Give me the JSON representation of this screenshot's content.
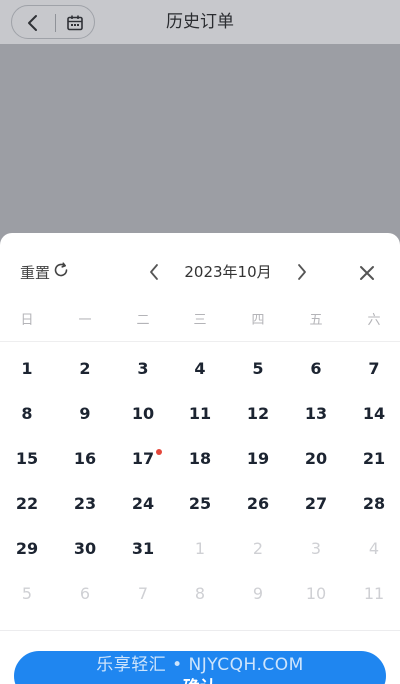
{
  "header": {
    "title": "历史订单",
    "back_icon": "chevron-left-icon",
    "calendar_icon": "calendar-icon"
  },
  "calendar": {
    "reset_label": "重置",
    "month_label": "2023年10月",
    "weekdays": [
      "日",
      "一",
      "二",
      "三",
      "四",
      "五",
      "六"
    ],
    "weeks": [
      [
        {
          "d": "1",
          "m": false
        },
        {
          "d": "2",
          "m": false
        },
        {
          "d": "3",
          "m": false
        },
        {
          "d": "4",
          "m": false
        },
        {
          "d": "5",
          "m": false
        },
        {
          "d": "6",
          "m": false
        },
        {
          "d": "7",
          "m": false
        }
      ],
      [
        {
          "d": "8",
          "m": false
        },
        {
          "d": "9",
          "m": false
        },
        {
          "d": "10",
          "m": false
        },
        {
          "d": "11",
          "m": false
        },
        {
          "d": "12",
          "m": false
        },
        {
          "d": "13",
          "m": false
        },
        {
          "d": "14",
          "m": false
        }
      ],
      [
        {
          "d": "15",
          "m": false
        },
        {
          "d": "16",
          "m": false
        },
        {
          "d": "17",
          "m": false,
          "dot": true
        },
        {
          "d": "18",
          "m": false
        },
        {
          "d": "19",
          "m": false
        },
        {
          "d": "20",
          "m": false
        },
        {
          "d": "21",
          "m": false
        }
      ],
      [
        {
          "d": "22",
          "m": false
        },
        {
          "d": "23",
          "m": false
        },
        {
          "d": "24",
          "m": false
        },
        {
          "d": "25",
          "m": false
        },
        {
          "d": "26",
          "m": false
        },
        {
          "d": "27",
          "m": false
        },
        {
          "d": "28",
          "m": false
        }
      ],
      [
        {
          "d": "29",
          "m": false
        },
        {
          "d": "30",
          "m": false
        },
        {
          "d": "31",
          "m": false
        },
        {
          "d": "1",
          "m": true
        },
        {
          "d": "2",
          "m": true
        },
        {
          "d": "3",
          "m": true
        },
        {
          "d": "4",
          "m": true
        }
      ],
      [
        {
          "d": "5",
          "m": true
        },
        {
          "d": "6",
          "m": true
        },
        {
          "d": "7",
          "m": true
        },
        {
          "d": "8",
          "m": true
        },
        {
          "d": "9",
          "m": true
        },
        {
          "d": "10",
          "m": true
        },
        {
          "d": "11",
          "m": true
        }
      ]
    ],
    "marker_color": "#e4473b"
  },
  "footer": {
    "confirm_label": "确认",
    "watermark": "乐享轻汇 • NJYCQH.COM"
  },
  "colors": {
    "accent": "#1f86f0",
    "overlay": "#9c9ea4"
  }
}
